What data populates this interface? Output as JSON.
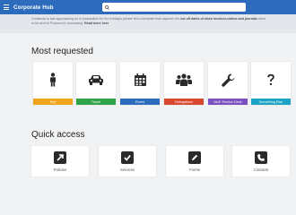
{
  "header": {
    "brand": "Corporate Hub",
    "search_placeholder": "",
    "bar_color": "#2d6bbd"
  },
  "notice": {
    "text_plain": "Christmas is fast approaching so in preparation for the holiday's please find a template that captures the ",
    "text_bold": "cut off dates of when invoices,claims and journals",
    "text_plain2": " need to be sent to Finance for processing. ",
    "link": "Read more here"
  },
  "most_requested": {
    "title": "Most requested",
    "tiles": [
      {
        "label": "Key",
        "icon": "person-icon",
        "color": "#f0a41c"
      },
      {
        "label": "Travel",
        "icon": "car-icon",
        "color": "#2fa24a"
      },
      {
        "label": "Event",
        "icon": "calendar-icon",
        "color": "#2d6bbd"
      },
      {
        "label": "Delegations",
        "icon": "group-icon",
        "color": "#d8462d"
      },
      {
        "label": "MoE Service Desk",
        "icon": "wrench-icon",
        "color": "#7a4fbf"
      },
      {
        "label": "Something Else",
        "icon": "question-icon",
        "color": "#1aa3c4"
      }
    ]
  },
  "quick_access": {
    "title": "Quick access",
    "items": [
      {
        "label": "Policies",
        "icon": "external-link-icon"
      },
      {
        "label": "Services",
        "icon": "checkbox-icon"
      },
      {
        "label": "Forms",
        "icon": "edit-icon"
      },
      {
        "label": "Contacts",
        "icon": "phone-icon"
      }
    ]
  }
}
